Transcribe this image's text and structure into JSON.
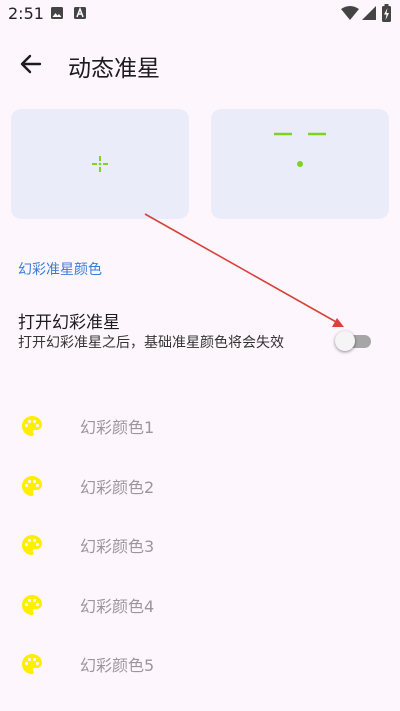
{
  "status": {
    "time": "2:51"
  },
  "appbar": {
    "title": "动态准星"
  },
  "section": {
    "title": "幻彩准星颜色"
  },
  "rainbow_switch": {
    "title": "打开幻彩准星",
    "description": "打开幻彩准星之后，基础准星颜色将会失效",
    "enabled": false
  },
  "colors": [
    {
      "label": "幻彩颜色1"
    },
    {
      "label": "幻彩颜色2"
    },
    {
      "label": "幻彩颜色3"
    },
    {
      "label": "幻彩颜色4"
    },
    {
      "label": "幻彩颜色5"
    }
  ],
  "theme": {
    "background": "#fdf7fd",
    "preview_bg": "#eaecf9",
    "crosshair": "#7ed321",
    "section_text": "#3b7bd6",
    "palette_icon": "#ffee00",
    "annotation_arrow": "#d9413a"
  }
}
